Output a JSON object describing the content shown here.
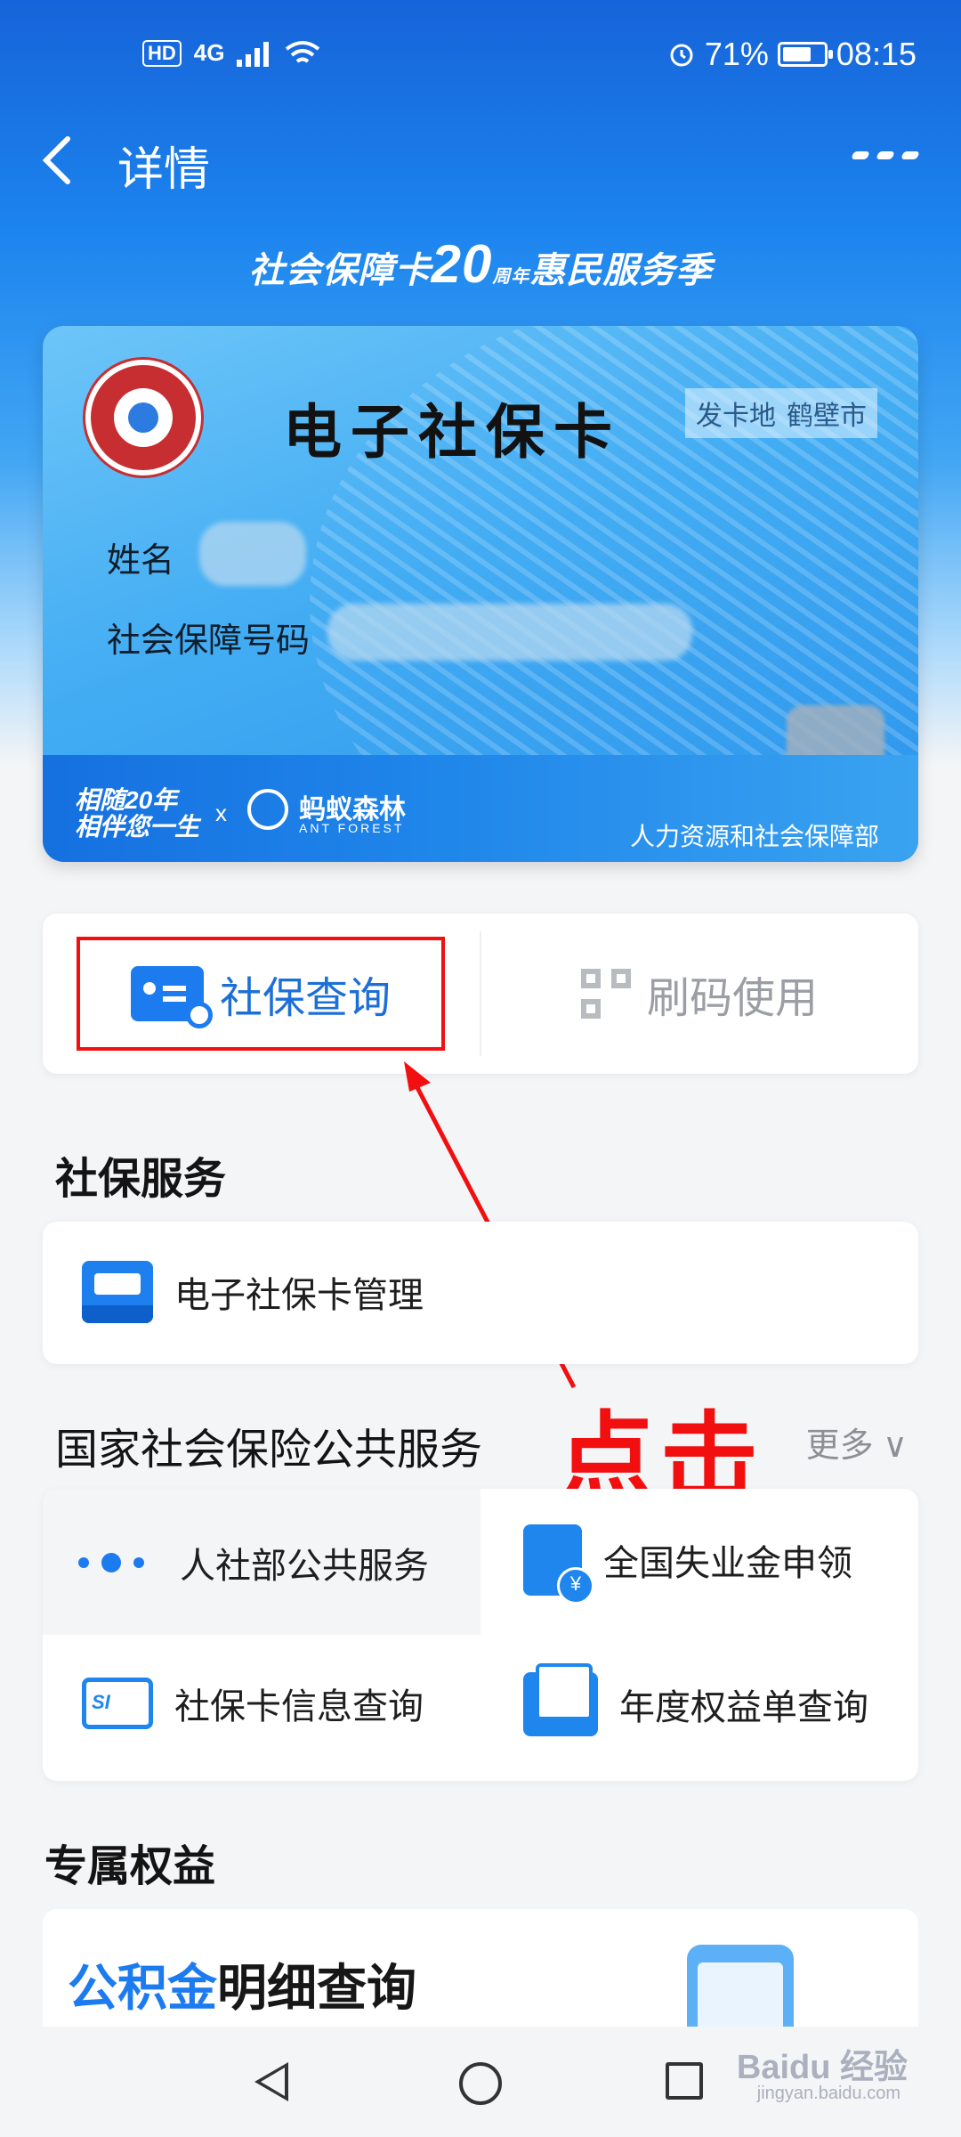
{
  "status_bar": {
    "hd": "HD",
    "network": "4G",
    "battery_percent": "71%",
    "battery_level": 0.71,
    "time": "08:15"
  },
  "nav": {
    "title": "详情"
  },
  "banner": {
    "prefix": "社会保障卡",
    "number": "20",
    "zhou": "周",
    "nian": "年",
    "suffix": "惠民服务季"
  },
  "card": {
    "title": "电子社保卡",
    "issue_label": "发卡地",
    "issue_place": "鹤壁市",
    "name_label": "姓名",
    "ssn_label": "社会保障号码",
    "slogan_line1": "相随20年",
    "slogan_line2": "相伴您一生",
    "partner_x": "x",
    "partner_name": "蚂蚁森林",
    "partner_en": "ANT FOREST",
    "issuer": "人力资源和社会保障部"
  },
  "actions": {
    "query": "社保查询",
    "scan": "刷码使用"
  },
  "social_services": {
    "title": "社保服务",
    "items": [
      {
        "label": "电子社保卡管理"
      }
    ]
  },
  "national_services": {
    "title": "国家社会保险公共服务",
    "more": "更多 ∨",
    "items": [
      {
        "label": "人社部公共服务"
      },
      {
        "label": "全国失业金申领"
      },
      {
        "label": "社保卡信息查询"
      },
      {
        "label": "年度权益单查询"
      }
    ]
  },
  "annotation": {
    "text": "点击"
  },
  "exclusive": {
    "title": "专属权益",
    "fund_accent": "公积金",
    "fund_rest": "明细查询"
  },
  "watermark": {
    "main": "Baidu 经验",
    "sub": "jingyan.baidu.com"
  },
  "colors": {
    "primary": "#1d7bf0",
    "highlight": "#f20f0f"
  }
}
